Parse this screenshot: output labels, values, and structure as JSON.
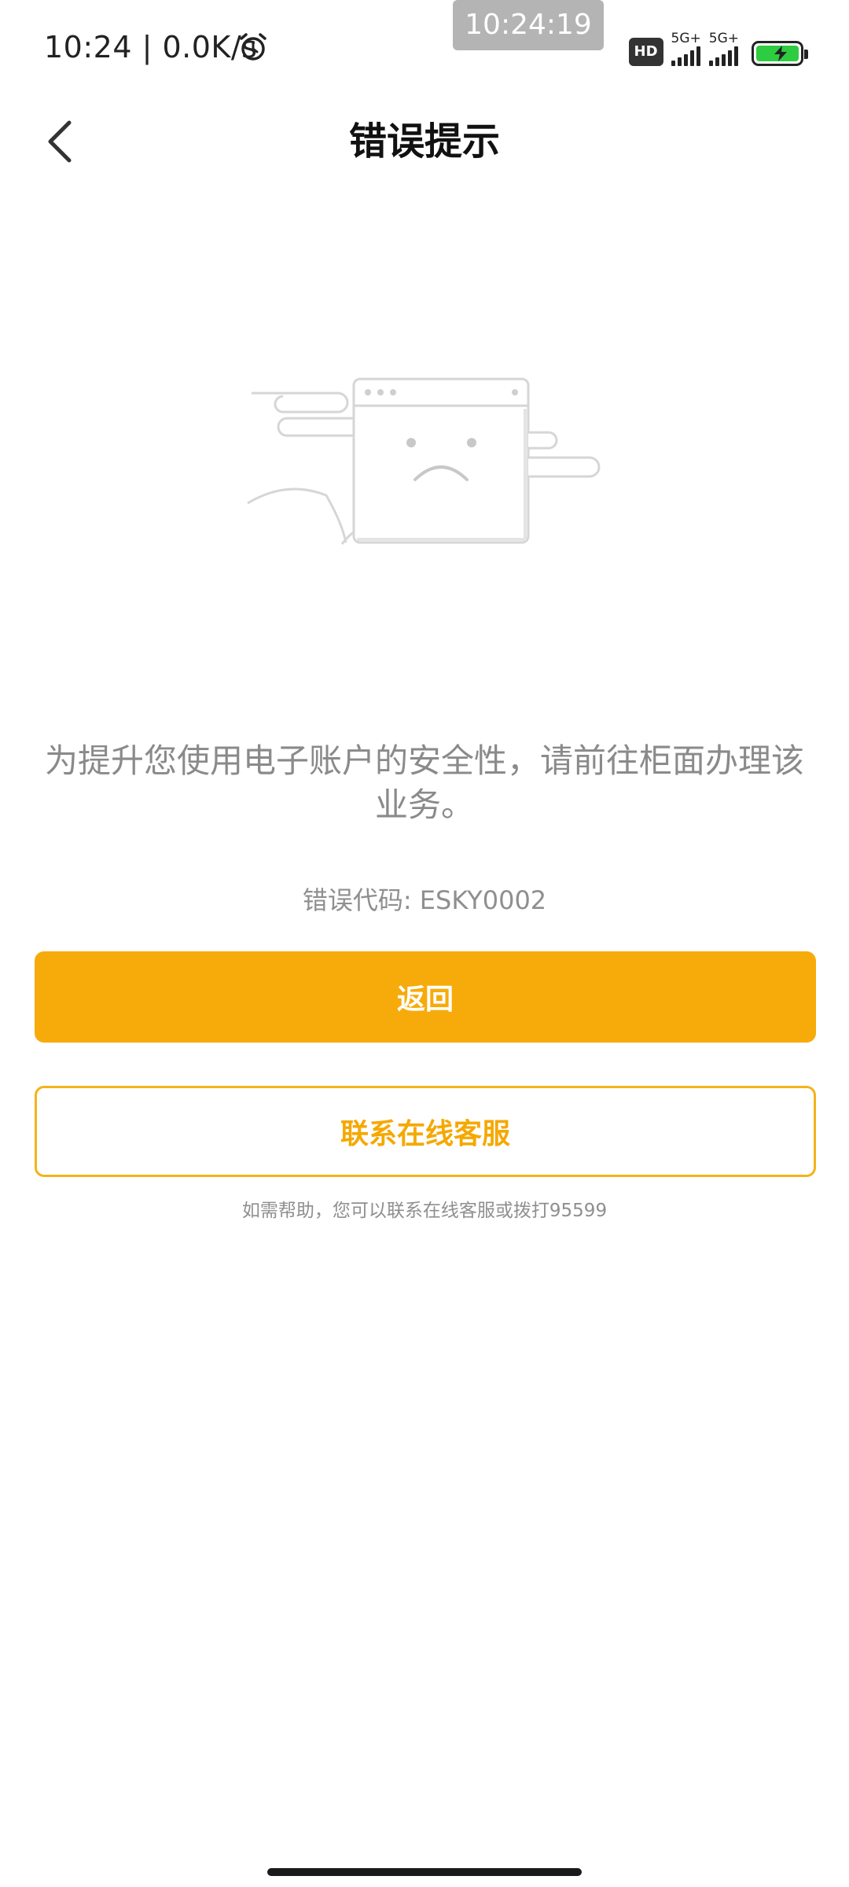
{
  "status_bar": {
    "time_speed": "10:24 | 0.0K/s",
    "overlay_clock": "10:24:19",
    "hd_badge": "HD",
    "network_1": "5G+",
    "network_2": "5G+",
    "battery_color": "#2ecc40"
  },
  "nav": {
    "back_icon": "chevron-left-icon",
    "title": "错误提示"
  },
  "illustration": {
    "icon": "sad-browser-window-icon"
  },
  "content": {
    "message": "为提升您使用电子账户的安全性，请前往柜面办理该业务。",
    "error_code_label": "错误代码:",
    "error_code_value": "ESKY0002"
  },
  "actions": {
    "primary_label": "返回",
    "secondary_label": "联系在线客服"
  },
  "help": {
    "text": "如需帮助，您可以联系在线客服或拨打95599"
  },
  "colors": {
    "accent": "#f7ab0a",
    "secondary_border": "#f3b31a",
    "muted_text": "#8a8a8a"
  }
}
